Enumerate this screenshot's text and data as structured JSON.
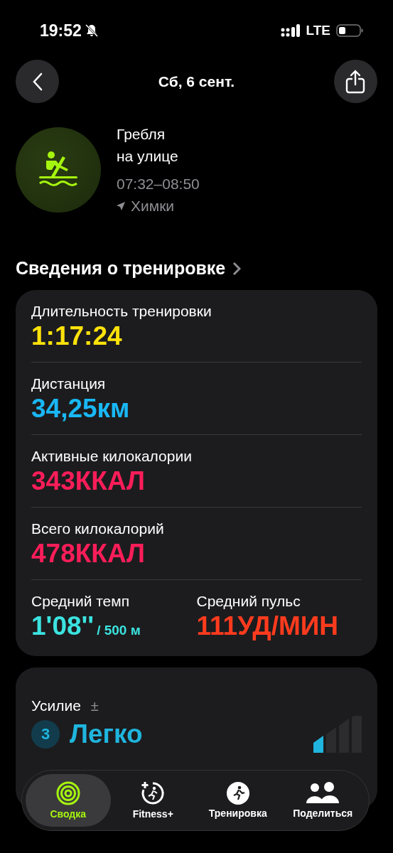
{
  "status_bar": {
    "time": "19:52",
    "network": "LTE"
  },
  "nav": {
    "title": "Сб, 6 сент."
  },
  "workout": {
    "title": [
      "Гребля",
      "на улице"
    ],
    "time_range": "07:32–08:50",
    "location": "Химки"
  },
  "section": {
    "title": "Сведения о тренировке"
  },
  "metrics": [
    {
      "kind": "full",
      "label": "Длительность тренировки",
      "value": "1:17:24",
      "color": "#ffe20a"
    },
    {
      "kind": "full",
      "label": "Дистанция",
      "value": "34,25км",
      "color": "#19b8f5"
    },
    {
      "kind": "full",
      "label": "Активные килокалории",
      "value": "343ККАЛ",
      "color": "#fa1d59"
    },
    {
      "kind": "full",
      "label": "Всего килокалорий",
      "value": "478ККАЛ",
      "color": "#fa1d59"
    },
    {
      "kind": "half",
      "label": "Средний темп",
      "value": "1'08''",
      "unit": "/ 500 м",
      "color": "#3be3e0"
    },
    {
      "kind": "half",
      "label": "Средний пульс",
      "value": "111УД/МИН",
      "color": "#ff3b1e"
    }
  ],
  "effort": {
    "label": "Усилие",
    "adjust": "±",
    "score": "3",
    "rating": "Легко",
    "level": 0.25
  },
  "tabs": [
    {
      "label": "Сводка",
      "selected": true
    },
    {
      "label": "Fitness+",
      "selected": false
    },
    {
      "label": "Тренировка",
      "selected": false
    },
    {
      "label": "Поделиться",
      "selected": false
    }
  ]
}
